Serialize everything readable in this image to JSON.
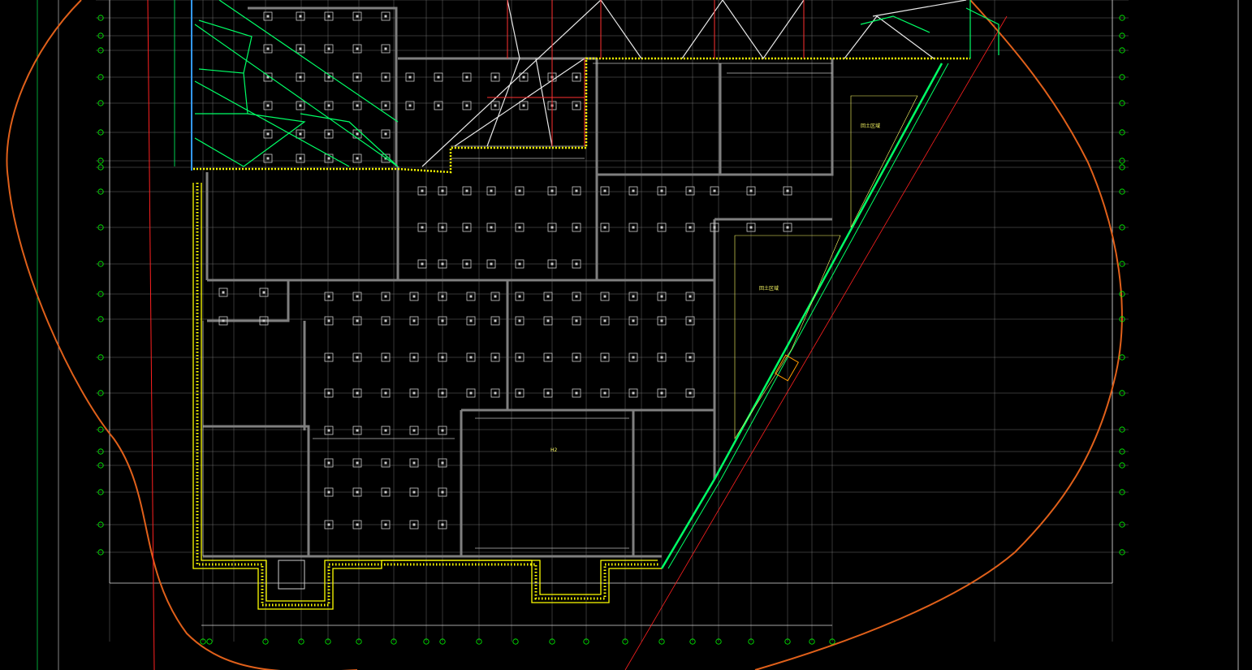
{
  "app": {
    "type": "cad-drawing-viewport",
    "background": "#000000"
  },
  "colors": {
    "grid": "#9a9a9a",
    "wall": "#7f7f7f",
    "retaining": "#ffff00",
    "hatch": "#ffff00",
    "truss": "#00ff66",
    "truss_white": "#e8e8e8",
    "truss_red": "#ff3030",
    "boundary": "#e0601a",
    "redline": "#ff2020",
    "axis_bubble": "#00ff00",
    "annotation": "#ff00ff",
    "fill_zone": "#ffff66",
    "blue_edge": "#3399ff"
  },
  "annotations": {
    "fill_zone_upper": "回土区域",
    "fill_zone_lower": "回土区域",
    "room_label_mid": "H2"
  },
  "icons": {
    "axis_bubble": "axis-bubble-icon",
    "column": "column-footing-icon"
  }
}
